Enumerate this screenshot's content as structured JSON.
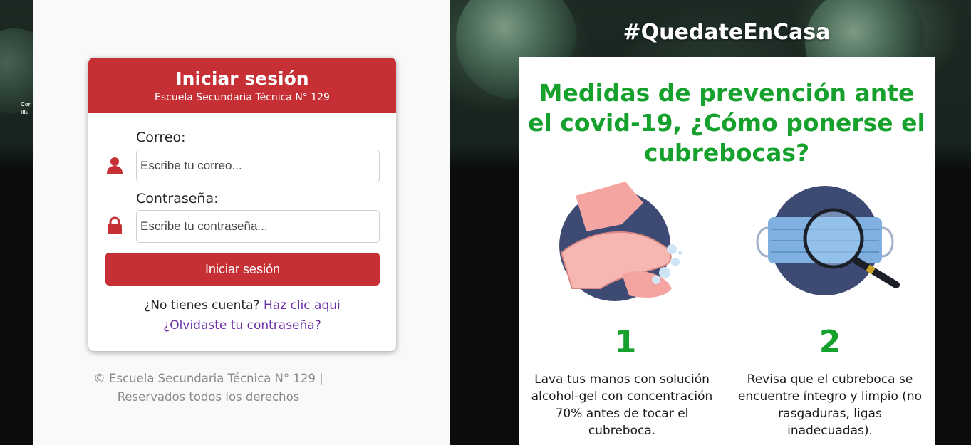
{
  "background": {
    "caption_line1": "Cor",
    "caption_line2": "illu"
  },
  "login": {
    "title": "Iniciar sesión",
    "subtitle": "Escuela Secundaria Técnica N° 129",
    "email_label": "Correo:",
    "email_placeholder": "Escribe tu correo...",
    "password_label": "Contraseña:",
    "password_placeholder": "Escribe tu contraseña...",
    "submit_label": "Iniciar sesión",
    "no_account_text": "¿No tienes cuenta?",
    "signup_link": "Haz clic aqui",
    "forgot_link": "¿Olvidaste tu contraseña?"
  },
  "footer": {
    "line1": "© Escuela Secundaria Técnica N° 129 |",
    "line2": "Reservados todos los derechos"
  },
  "infographic": {
    "hashtag": "#QuedateEnCasa",
    "title": "Medidas de prevención ante el covid-19, ¿Cómo ponerse el cubrebocas?",
    "steps": [
      {
        "number": "1",
        "text": "Lava tus manos con solución alcohol-gel con concentración 70% antes de tocar el cubreboca."
      },
      {
        "number": "2",
        "text": "Revisa que el cubreboca se encuentre íntegro y limpio (no rasgaduras, ligas inadecuadas)."
      }
    ]
  },
  "colors": {
    "brand_red": "#c62f33",
    "accent_green": "#16a02c",
    "link_purple": "#6b2fa8"
  },
  "icons": [
    "user-icon",
    "lock-icon",
    "hand-washing-illustration",
    "mask-magnifier-illustration"
  ]
}
